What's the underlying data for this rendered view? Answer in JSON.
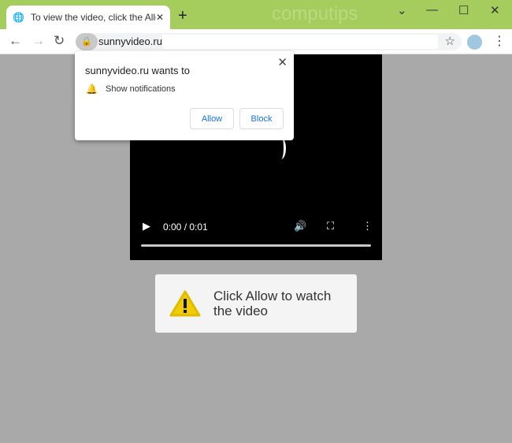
{
  "browser": {
    "tab_title": "To view the video, click the Allow",
    "watermark": "computips",
    "url": "sunnyvideo.ru/",
    "colors": {
      "frame": "#a4cd5d",
      "accent": "#1a73e8"
    }
  },
  "permission": {
    "title": "sunnyvideo.ru wants to",
    "permission": "Show notifications",
    "allow": "Allow",
    "block": "Block"
  },
  "video": {
    "time": "0:00 / 0:01",
    "progress": 0
  },
  "message": {
    "text": "Click Allow to watch the video"
  }
}
